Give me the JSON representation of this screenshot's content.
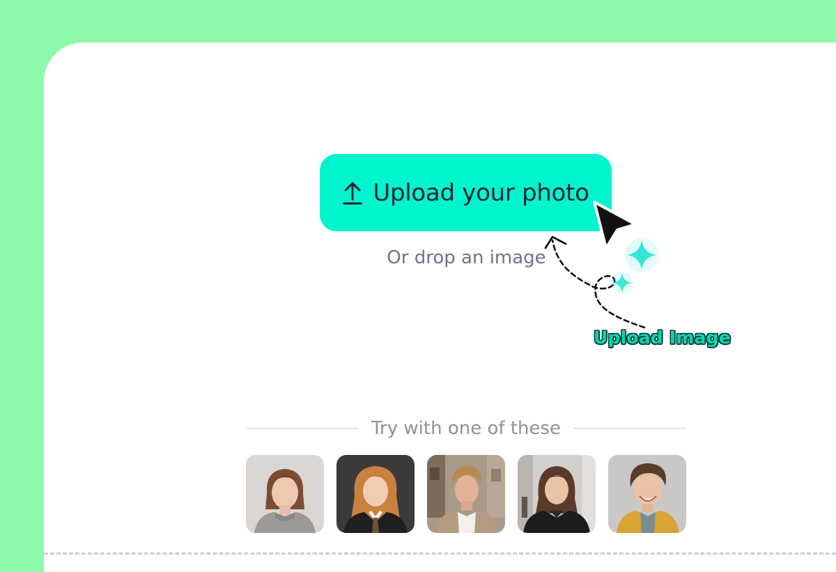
{
  "upload": {
    "button_label": "Upload your photo",
    "button_icon": "upload-arrow-icon",
    "drop_text": "Or drop an image"
  },
  "annotation": {
    "label": "Upload Image",
    "cursor_icon": "cursor-arrow-icon",
    "sparkle_icon": "sparkle-icon"
  },
  "samples": {
    "heading": "Try with one of these",
    "items": [
      {
        "name": "sample-woman-bob-gray-sweater"
      },
      {
        "name": "sample-woman-red-hair-tie"
      },
      {
        "name": "sample-man-street-cardigan"
      },
      {
        "name": "sample-woman-black-coat"
      },
      {
        "name": "sample-man-smiling-yellow-jacket"
      }
    ]
  },
  "colors": {
    "background": "#8ef9aa",
    "accent": "#00f5cf",
    "label_accent": "#00d9b4"
  }
}
